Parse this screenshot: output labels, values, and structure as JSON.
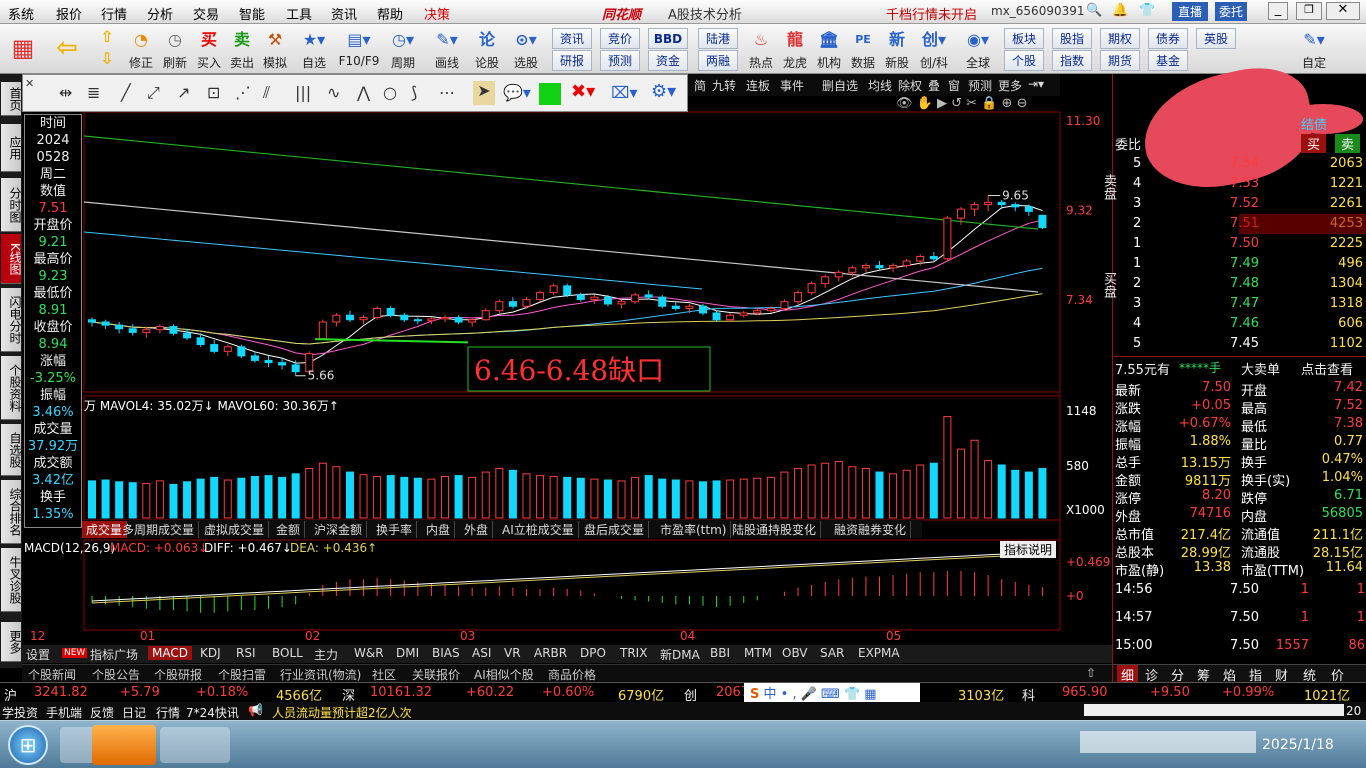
{
  "menu": {
    "items": [
      "系统",
      "报价",
      "行情",
      "分析",
      "交易",
      "智能",
      "工具",
      "资讯",
      "帮助",
      "决策"
    ],
    "logo": "同花顺",
    "subtitle": "A股技术分析",
    "notice": "千档行情未开启",
    "user": "mx_656090391",
    "right_buttons": [
      "直播",
      "委托"
    ]
  },
  "toolbar": {
    "buttons": [
      "修正",
      "刷新",
      "买入",
      "卖出",
      "模拟",
      "自选",
      "F10/F9",
      "周期",
      "画线",
      "论股",
      "选股"
    ],
    "grid": [
      [
        "资讯",
        "竞价",
        "BBD",
        "陆港"
      ],
      [
        "研报",
        "预测",
        "资金",
        "两融"
      ]
    ],
    "buttons2": [
      "热点",
      "龙虎",
      "机构",
      "数据",
      "新股",
      "创/科",
      "全球"
    ],
    "grid2": [
      [
        "板块",
        "股指",
        "期权",
        "债券",
        "英股"
      ],
      [
        "个股",
        "指数",
        "期货",
        "基金"
      ]
    ],
    "last": "自定"
  },
  "left_tabs": [
    "首页",
    "应用",
    "分时图",
    "K线图",
    "闪电分时",
    "个股资料",
    "自选股",
    "综合排名",
    "牛叉诊股",
    "更多"
  ],
  "period_bar": [
    "简",
    "九转",
    "连板",
    "事件",
    "删自选",
    "均线",
    "除权",
    "叠",
    "窗",
    "预测",
    "更多"
  ],
  "info_panel": {
    "time_label": "时间",
    "year": "2024",
    "date": "0528",
    "weekday": "周二",
    "value_label": "数值",
    "value": "7.51",
    "open_label": "开盘价",
    "open": "9.21",
    "high_label": "最高价",
    "high": "9.23",
    "low_label": "最低价",
    "low": "8.91",
    "close_label": "收盘价",
    "close": "8.94",
    "chg_label": "涨幅",
    "chg": "-3.25%",
    "amp_label": "振幅",
    "amp": "3.46%",
    "vol_label": "成交量",
    "vol": "37.92万",
    "amt_label": "成交额",
    "amt": "3.42亿",
    "turn_label": "换手",
    "turn": "1.35%"
  },
  "chart_data": {
    "type": "candlestick",
    "price_axis": [
      "11.30",
      "9.32",
      "7.34"
    ],
    "y_range": [
      5.3,
      11.5
    ],
    "high_marker": "9.65",
    "low_marker": "5.66",
    "annotation": "6.46-6.48缺口",
    "ohlc": [
      [
        6.9,
        6.95,
        6.75,
        6.85
      ],
      [
        6.85,
        6.9,
        6.7,
        6.78
      ],
      [
        6.78,
        6.85,
        6.6,
        6.7
      ],
      [
        6.7,
        6.8,
        6.55,
        6.62
      ],
      [
        6.62,
        6.75,
        6.5,
        6.68
      ],
      [
        6.68,
        6.8,
        6.6,
        6.75
      ],
      [
        6.75,
        6.8,
        6.55,
        6.6
      ],
      [
        6.6,
        6.7,
        6.45,
        6.5
      ],
      [
        6.5,
        6.6,
        6.3,
        6.35
      ],
      [
        6.35,
        6.45,
        6.15,
        6.2
      ],
      [
        6.2,
        6.35,
        6.1,
        6.3
      ],
      [
        6.3,
        6.35,
        6.05,
        6.1
      ],
      [
        6.1,
        6.2,
        5.95,
        6.0
      ],
      [
        6.0,
        6.1,
        5.85,
        5.95
      ],
      [
        5.95,
        6.05,
        5.8,
        5.9
      ],
      [
        5.9,
        6.0,
        5.66,
        5.75
      ],
      [
        5.75,
        6.2,
        5.7,
        6.15
      ],
      [
        6.48,
        6.9,
        6.46,
        6.85
      ],
      [
        6.85,
        7.05,
        6.75,
        7.0
      ],
      [
        7.0,
        7.1,
        6.85,
        6.9
      ],
      [
        6.9,
        7.0,
        6.8,
        6.95
      ],
      [
        6.95,
        7.2,
        6.9,
        7.15
      ],
      [
        7.15,
        7.2,
        6.95,
        7.0
      ],
      [
        7.0,
        7.05,
        6.85,
        6.9
      ],
      [
        6.9,
        6.95,
        6.8,
        6.88
      ],
      [
        6.88,
        6.95,
        6.8,
        6.92
      ],
      [
        6.92,
        7.0,
        6.85,
        6.95
      ],
      [
        6.95,
        7.0,
        6.8,
        6.85
      ],
      [
        6.85,
        6.95,
        6.75,
        6.9
      ],
      [
        6.9,
        7.15,
        6.88,
        7.1
      ],
      [
        7.1,
        7.35,
        7.05,
        7.3
      ],
      [
        7.3,
        7.4,
        7.15,
        7.2
      ],
      [
        7.2,
        7.4,
        7.15,
        7.35
      ],
      [
        7.35,
        7.55,
        7.3,
        7.5
      ],
      [
        7.5,
        7.7,
        7.45,
        7.65
      ],
      [
        7.65,
        7.7,
        7.4,
        7.45
      ],
      [
        7.45,
        7.5,
        7.3,
        7.35
      ],
      [
        7.35,
        7.45,
        7.25,
        7.4
      ],
      [
        7.4,
        7.45,
        7.2,
        7.25
      ],
      [
        7.25,
        7.35,
        7.15,
        7.3
      ],
      [
        7.3,
        7.5,
        7.25,
        7.45
      ],
      [
        7.45,
        7.55,
        7.35,
        7.4
      ],
      [
        7.4,
        7.45,
        7.15,
        7.2
      ],
      [
        7.2,
        7.3,
        7.1,
        7.15
      ],
      [
        7.15,
        7.25,
        7.05,
        7.2
      ],
      [
        7.2,
        7.25,
        7.0,
        7.05
      ],
      [
        7.05,
        7.1,
        6.85,
        6.9
      ],
      [
        6.9,
        7.05,
        6.85,
        7.0
      ],
      [
        7.0,
        7.1,
        6.95,
        7.05
      ],
      [
        7.05,
        7.15,
        7.0,
        7.1
      ],
      [
        7.1,
        7.2,
        7.05,
        7.15
      ],
      [
        7.15,
        7.35,
        7.1,
        7.3
      ],
      [
        7.3,
        7.55,
        7.25,
        7.5
      ],
      [
        7.5,
        7.75,
        7.45,
        7.7
      ],
      [
        7.7,
        7.9,
        7.6,
        7.85
      ],
      [
        7.85,
        8.0,
        7.75,
        7.95
      ],
      [
        7.95,
        8.1,
        7.85,
        8.05
      ],
      [
        8.05,
        8.15,
        7.95,
        8.1
      ],
      [
        8.1,
        8.2,
        8.0,
        8.05
      ],
      [
        8.05,
        8.15,
        7.95,
        8.1
      ],
      [
        8.1,
        8.25,
        8.05,
        8.2
      ],
      [
        8.2,
        8.35,
        8.1,
        8.3
      ],
      [
        8.3,
        8.4,
        8.2,
        8.25
      ],
      [
        8.25,
        9.2,
        8.2,
        9.15
      ],
      [
        9.15,
        9.4,
        9.0,
        9.35
      ],
      [
        9.35,
        9.5,
        9.2,
        9.45
      ],
      [
        9.45,
        9.65,
        9.3,
        9.5
      ],
      [
        9.5,
        9.55,
        9.35,
        9.45
      ],
      [
        9.45,
        9.5,
        9.3,
        9.4
      ],
      [
        9.4,
        9.45,
        9.2,
        9.3
      ],
      [
        9.21,
        9.23,
        8.91,
        8.94
      ]
    ],
    "volume_axis": [
      "1148",
      "580",
      "X1000"
    ],
    "volume_legend": "万  MAVOL4: 35.02万↓  MAVOL60: 30.36万↑",
    "volume": [
      420,
      430,
      410,
      400,
      390,
      420,
      380,
      410,
      440,
      460,
      430,
      450,
      470,
      480,
      460,
      500,
      560,
      620,
      580,
      520,
      490,
      470,
      480,
      460,
      450,
      440,
      470,
      480,
      460,
      520,
      560,
      540,
      500,
      480,
      470,
      460,
      450,
      440,
      430,
      420,
      460,
      480,
      440,
      430,
      420,
      410,
      420,
      430,
      440,
      450,
      460,
      520,
      560,
      600,
      620,
      640,
      580,
      560,
      520,
      500,
      540,
      600,
      620,
      1148,
      780,
      880,
      650,
      600,
      540,
      520,
      560
    ],
    "macd_legend": {
      "name": "MACD(12,26,9)",
      "macd": "MACD: +0.063↓",
      "diff": "DIFF: +0.467↓",
      "dea": "DEA: +0.436↑"
    },
    "macd_axis": [
      "+0.469",
      "+0"
    ],
    "macd_hist": [
      -0.05,
      -0.06,
      -0.07,
      -0.08,
      -0.09,
      -0.1,
      -0.1,
      -0.11,
      -0.12,
      -0.12,
      -0.11,
      -0.1,
      -0.1,
      -0.09,
      -0.08,
      -0.06,
      0.02,
      0.08,
      0.1,
      0.12,
      0.12,
      0.13,
      0.12,
      0.11,
      0.1,
      0.09,
      0.08,
      0.07,
      0.06,
      0.06,
      0.07,
      0.06,
      0.05,
      0.05,
      0.06,
      0.05,
      0.04,
      0.02,
      0.0,
      -0.02,
      -0.03,
      -0.04,
      -0.05,
      -0.06,
      -0.06,
      -0.07,
      -0.08,
      -0.07,
      -0.05,
      -0.03,
      0.0,
      0.03,
      0.06,
      0.08,
      0.1,
      0.12,
      0.13,
      0.14,
      0.14,
      0.15,
      0.16,
      0.17,
      0.17,
      0.18,
      0.18,
      0.17,
      0.15,
      0.12,
      0.1,
      0.08,
      0.063
    ],
    "x_labels": [
      "12",
      "01",
      "02",
      "03",
      "04",
      "05"
    ]
  },
  "indicator_btn": "指标说明",
  "volume_tabs": [
    "成交量",
    "多周期成交量",
    "虚拟成交量",
    "金额",
    "沪深金额",
    "换手率",
    "内盘",
    "外盘",
    "AI立桩成交量",
    "盘后成交量",
    "市盈率(ttm)",
    "陆股通持股变化",
    "融资融券变化"
  ],
  "indicator_tabs": [
    "设置",
    "NEW",
    "指标广场",
    "MACD",
    "KDJ",
    "RSI",
    "BOLL",
    "主力",
    "W&R",
    "DMI",
    "BIAS",
    "ASI",
    "VR",
    "ARBR",
    "DPO",
    "TRIX",
    "新DMA",
    "BBI",
    "MTM",
    "OBV",
    "SAR",
    "EXPMA"
  ],
  "news_tabs": [
    "个股新闻",
    "个股公告",
    "个股研报",
    "个股扫雷",
    "行业资讯(物流)",
    "社区",
    "关联报价",
    "AI相似个股",
    "商品价格"
  ],
  "right": {
    "header": "委比",
    "top_btns": [
      "买",
      "卖"
    ],
    "link": "结债",
    "asks": [
      [
        "5",
        "7.54",
        "2063"
      ],
      [
        "4",
        "7.53",
        "1221"
      ],
      [
        "3",
        "7.52",
        "2261"
      ],
      [
        "2",
        "7.51",
        "4253"
      ],
      [
        "1",
        "7.50",
        "2225"
      ]
    ],
    "bids": [
      [
        "1",
        "7.49",
        "496"
      ],
      [
        "2",
        "7.48",
        "1304"
      ],
      [
        "3",
        "7.47",
        "1318"
      ],
      [
        "4",
        "7.46",
        "606"
      ],
      [
        "5",
        "7.45",
        "1102"
      ]
    ],
    "sell_label": "卖盘",
    "buy_label": "买盘",
    "big_order": [
      "7.55元有",
      "*****手",
      "大卖单",
      "点击查看"
    ],
    "stats": [
      [
        "最新",
        "7.50",
        "开盘",
        "7.42"
      ],
      [
        "涨跌",
        "+0.05",
        "最高",
        "7.52"
      ],
      [
        "涨幅",
        "+0.67%",
        "最低",
        "7.38"
      ],
      [
        "振幅",
        "1.88%",
        "量比",
        "0.77"
      ],
      [
        "总手",
        "13.15万",
        "换手",
        "0.47%"
      ],
      [
        "金额",
        "9811万",
        "换手(实)",
        "1.04%"
      ],
      [
        "涨停",
        "8.20",
        "跌停",
        "6.71"
      ],
      [
        "外盘",
        "74716",
        "内盘",
        "56805"
      ],
      [
        "总市值",
        "217.4亿",
        "流通值",
        "211.1亿"
      ],
      [
        "总股本",
        "28.99亿",
        "流通股",
        "28.15亿"
      ],
      [
        "市盈(静)",
        "13.38",
        "市盈(TTM)",
        "11.64"
      ]
    ],
    "ticks": [
      [
        "14:56",
        "7.50",
        "1",
        "1"
      ],
      [
        "14:57",
        "7.50",
        "1",
        "1"
      ],
      [
        "15:00",
        "7.50",
        "1557",
        "86"
      ]
    ],
    "bottom_tabs": [
      "细",
      "诊",
      "分",
      "筹",
      "焰",
      "指",
      "财",
      "统",
      "价"
    ]
  },
  "indexbar": {
    "sh_label": "沪",
    "sh": "3241.82",
    "sh_chg": "+5.79",
    "sh_pct": "+0.18%",
    "sh_amt": "4566亿",
    "sz_label": "深",
    "sz": "10161.32",
    "sz_chg": "+60.22",
    "sz_pct": "+0.60%",
    "sz_amt": "6790亿",
    "cy_label": "创",
    "cy": "2067",
    "ime": "中 • , ",
    "cy_amt": "3103亿",
    "kc_label": "科",
    "kc": "965.90",
    "kc_chg": "+9.50",
    "kc_pct": "+0.99%",
    "kc_amt": "1021亿"
  },
  "infobar": {
    "items": [
      "学投资",
      "手机端",
      "反馈",
      "日记",
      "行情",
      "7*24快讯"
    ],
    "news": "人员流动量预计超2亿人次",
    "right": "20"
  },
  "taskbar": {
    "clock": "2025/1/18"
  }
}
